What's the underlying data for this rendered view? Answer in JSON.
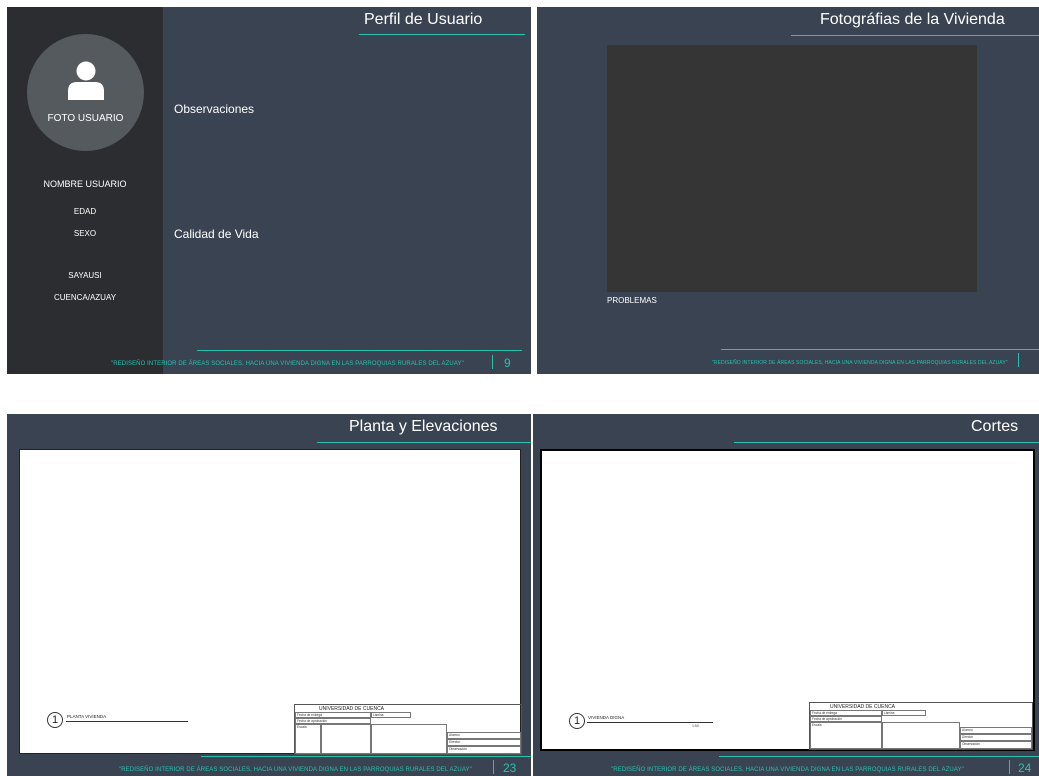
{
  "slide1": {
    "title": "Perfil de Usuario",
    "avatar_label": "FOTO USUARIO",
    "name": "NOMBRE USUARIO",
    "age": "EDAD",
    "sex": "SEXO",
    "place1": "SAYAUSI",
    "place2": "CUENCA/AZUAY",
    "section1": "Observaciones",
    "section2": "Calidad de Vida",
    "footer": "\"REDISEÑO INTERIOR DE ÁREAS SOCIALES, HACIA UNA VIVIENDA DIGNA EN LAS PARROQUIAS RURALES DEL AZUAY\"",
    "page": "9"
  },
  "slide2": {
    "title": "Fotográfias de la Vivienda",
    "problems": "PROBLEMAS",
    "footer": "\"REDISEÑO INTERIOR DE ÁREAS SOCIALES, HACIA UNA VIVIENDA DIGNA EN LAS PARROQUIAS RURALES DEL AZUAY\""
  },
  "slide3": {
    "title": "Planta y Elevaciones",
    "marker": "1",
    "marker_label": "PLANTA VIVIENDA",
    "tb_university": "UNIVERSIDAD DE CUENCA",
    "tb_fecha_entrega": "Fecha de entrega",
    "tb_fecha_aprobacion": "Fecha de aprobación",
    "tb_lamina": "Lámina",
    "tb_escala": "Escala",
    "tb_alumno": "Alumno",
    "tb_director": "Director",
    "tb_observacion": "Observación",
    "footer": "\"REDISEÑO INTERIOR DE ÁREAS SOCIALES, HACIA UNA VIVIENDA DIGNA EN LAS PARROQUIAS RURALES DEL AZUAY\"",
    "page": "23"
  },
  "slide4": {
    "title": "Cortes",
    "marker": "1",
    "marker_label": "VIVIENDA DIGNA",
    "marker_scale": "1:50",
    "tb_university": "UNIVERSIDAD DE CUENCA",
    "tb_fecha_entrega": "Fecha de entrega",
    "tb_fecha_aprobacion": "Fecha de aprobación",
    "tb_lamina": "Lámina",
    "tb_escala": "Escala",
    "tb_alumno": "Alumno",
    "tb_director": "Director",
    "tb_observacion": "Observación",
    "footer": "\"REDISEÑO INTERIOR DE ÁREAS SOCIALES, HACIA UNA VIVIENDA DIGNA EN LAS PARROQUIAS RURALES DEL AZUAY\"",
    "page": "24"
  },
  "colors": {
    "slide_bg": "#3a4352",
    "sidebar_bg": "#2b2d30",
    "accent": "#27c2ae",
    "photo_placeholder": "#353535"
  },
  "icons": {
    "avatar": "user-icon"
  }
}
